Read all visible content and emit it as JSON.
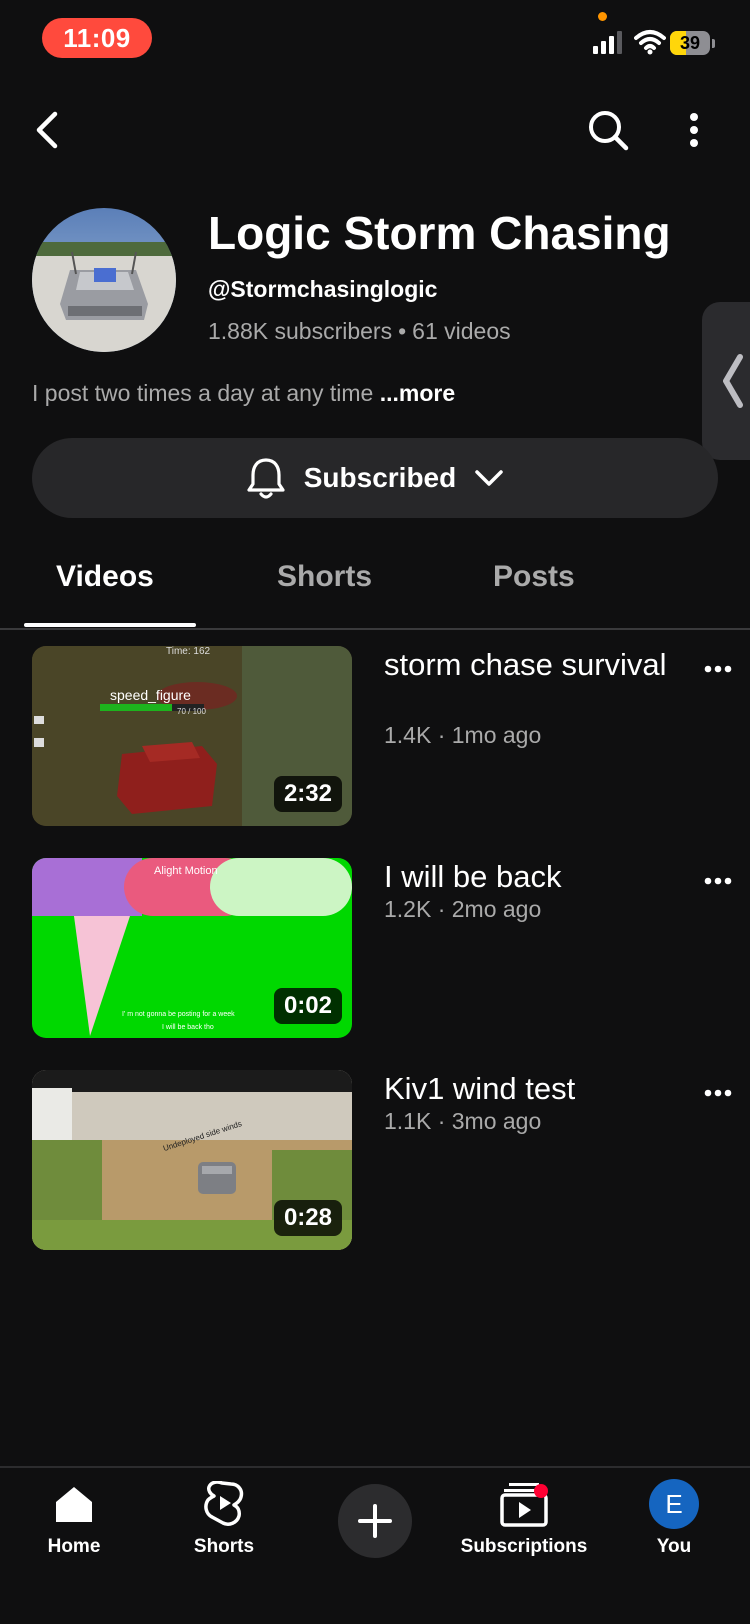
{
  "status_bar": {
    "time": "11:09",
    "battery": "39",
    "battery_level": 0.39
  },
  "top_nav": {
    "back_icon": "back-chevron-icon",
    "search_icon": "search-icon",
    "menu_icon": "more-vert-icon"
  },
  "channel": {
    "name": "Logic Storm Chasing",
    "handle": "@Stormchasinglogic",
    "subscribers": "1.88K subscribers",
    "separator": "•",
    "video_count": "61 videos",
    "description": "I post two times a day at any time",
    "more_label": "...more"
  },
  "subscribe": {
    "label": "Subscribed",
    "bell_icon": "bell-icon",
    "chevron_icon": "chevron-down-icon"
  },
  "tabs": [
    {
      "label": "Videos",
      "active": true
    },
    {
      "label": "Shorts",
      "active": false
    },
    {
      "label": "Posts",
      "active": false
    }
  ],
  "videos": [
    {
      "title": " storm chase survival",
      "meta": "1.4K · 1mo ago",
      "duration": "2:32",
      "overlay": {
        "time": "Time: 162",
        "bar_label": "speed_figure",
        "bar_value": "70 / 100"
      }
    },
    {
      "title": "I will be back",
      "meta": "1.2K · 2mo ago",
      "duration": "0:02",
      "overlay": {
        "watermark": "Alight Motion",
        "caption_1": "I' m not gonna be posting for a week",
        "caption_2": "I will be back tho"
      }
    },
    {
      "title": "Kiv1 wind test",
      "meta": "1.1K · 3mo ago",
      "duration": "0:28",
      "overlay": {
        "caption": "Undeployed side winds"
      }
    }
  ],
  "bottom_nav": {
    "home": "Home",
    "shorts": "Shorts",
    "subscriptions": "Subscriptions",
    "you": "You",
    "you_initial": "E"
  },
  "colors": {
    "background": "#0f0f10",
    "time_pill": "#ff4a3d",
    "muted_text": "#aaaaaa",
    "avatar_blue": "#1565c0",
    "notification_red": "#ff0033"
  }
}
